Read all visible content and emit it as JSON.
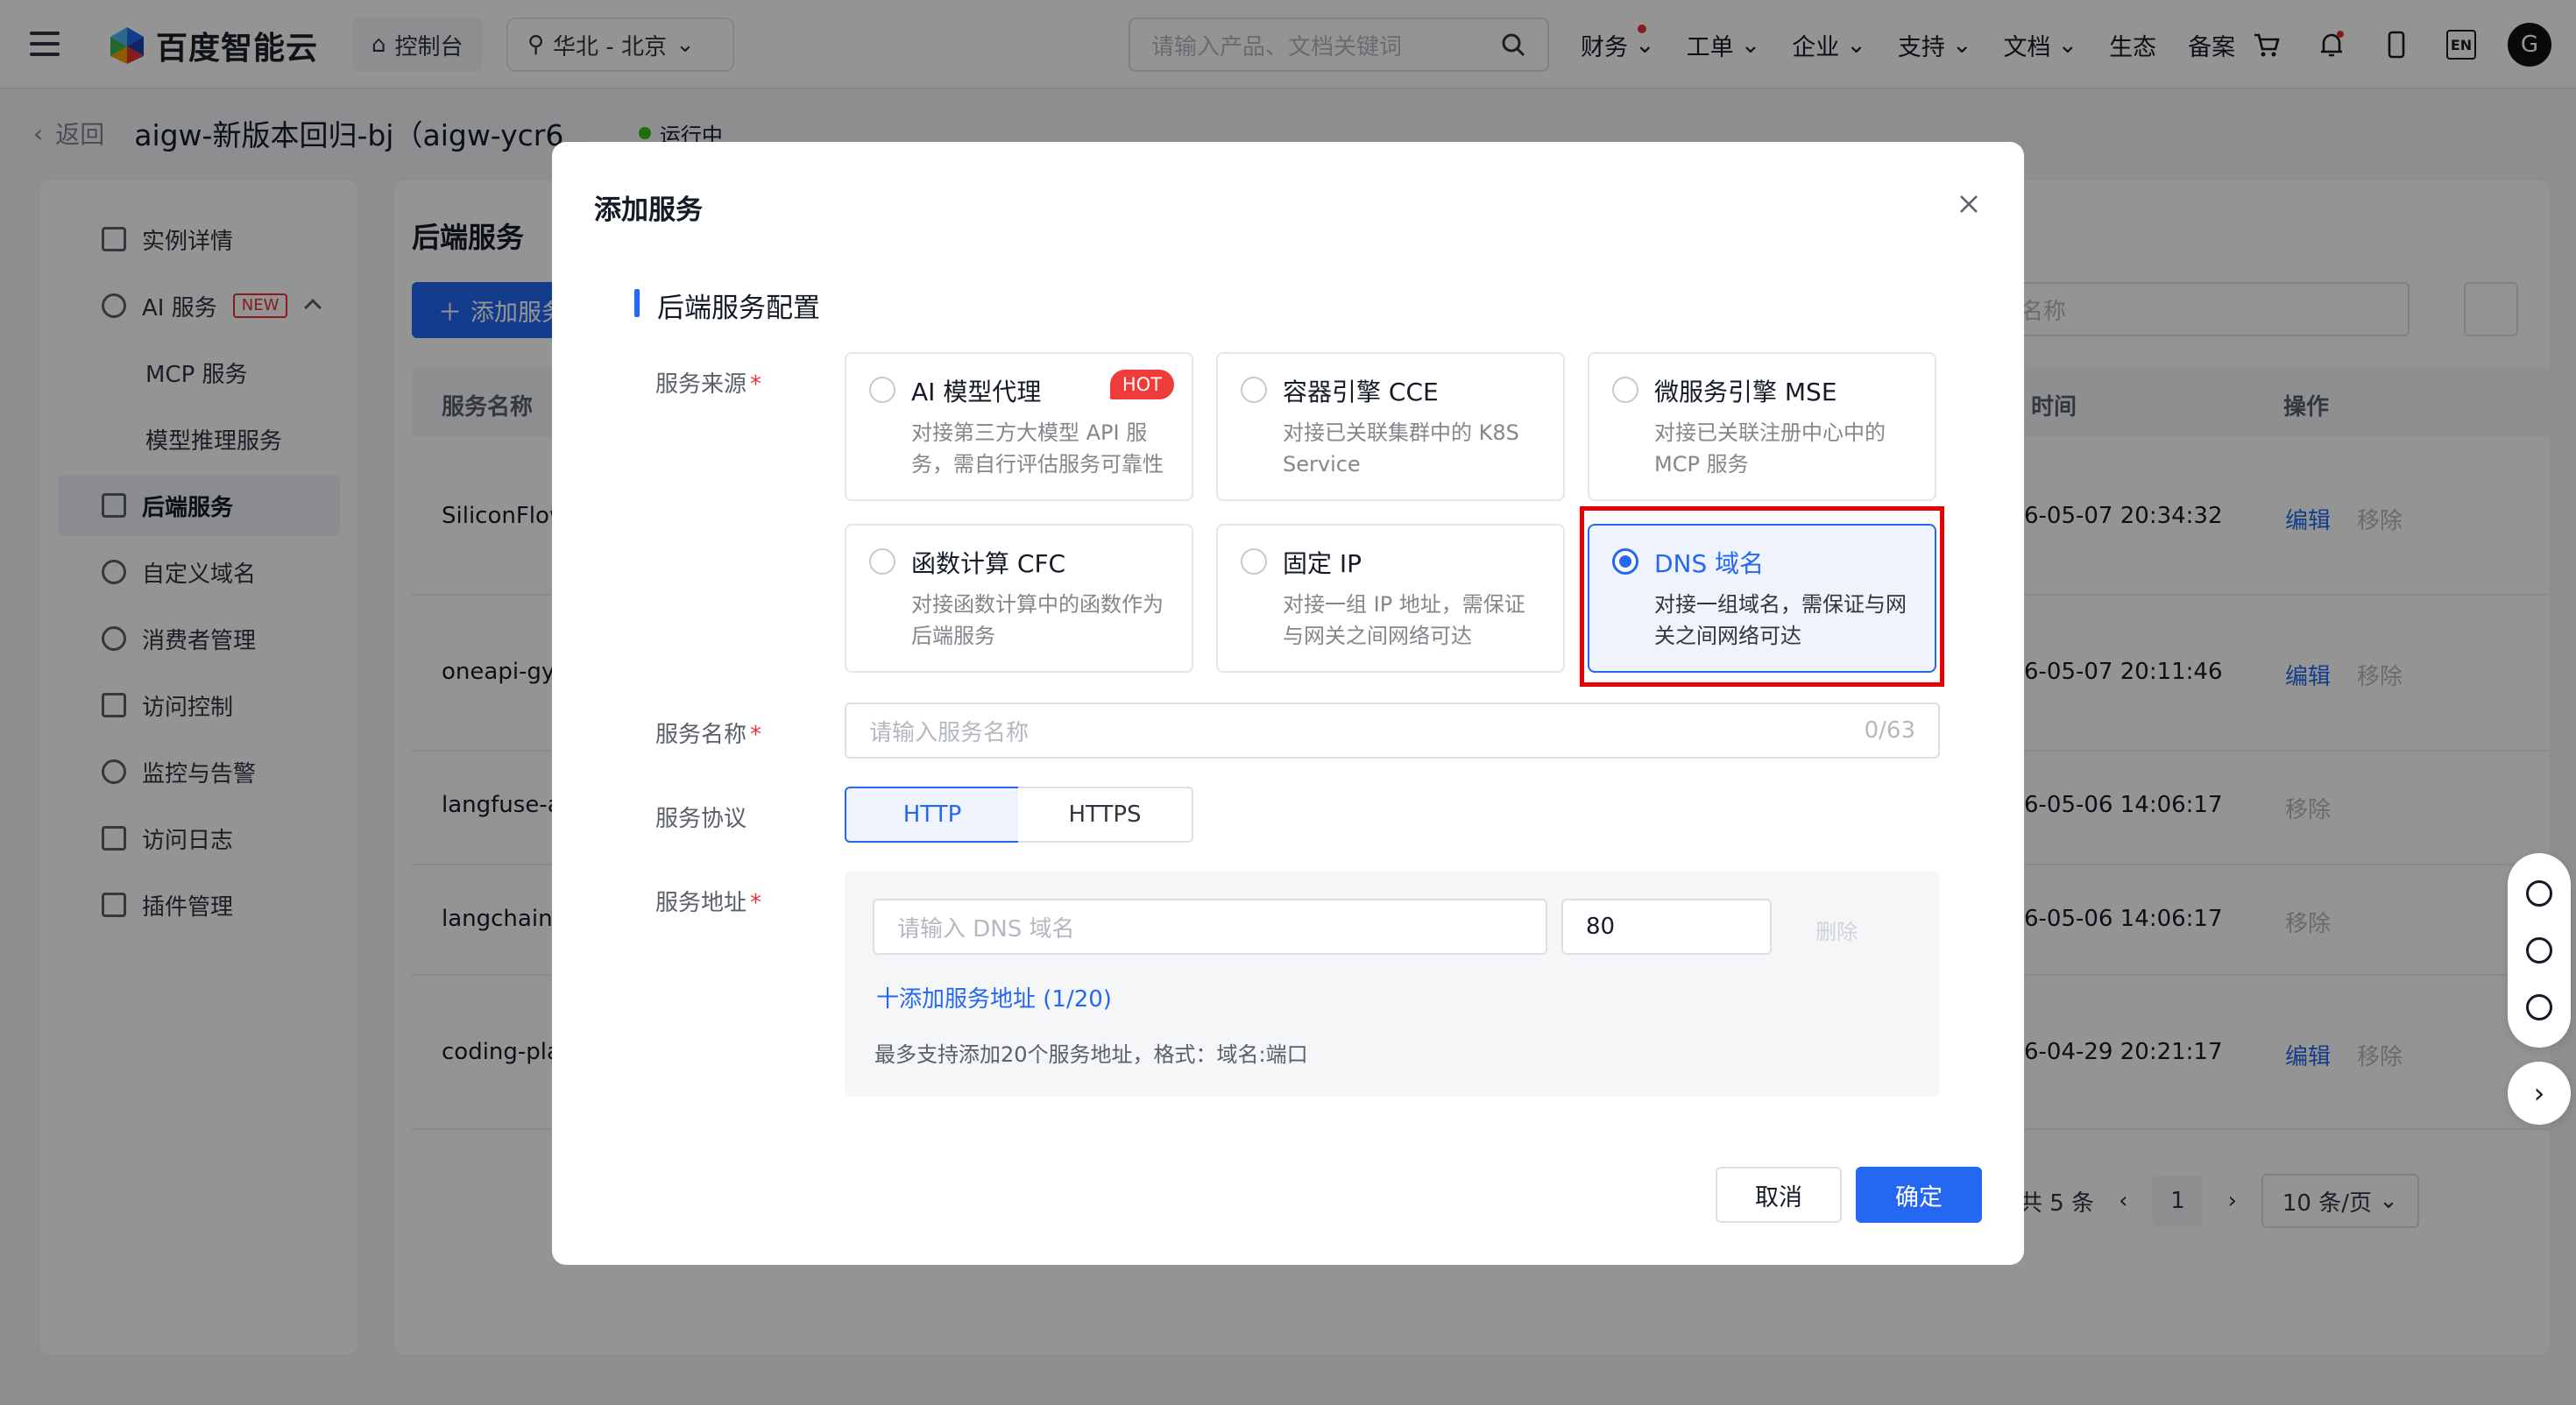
{
  "topnav": {
    "logo_text": "百度智能云",
    "console_label": "控制台",
    "region_label": "华北 - 北京",
    "search_placeholder": "请输入产品、文档关键词",
    "links": [
      "财务",
      "工单",
      "企业",
      "支持",
      "文档",
      "生态",
      "备案"
    ],
    "lang": "EN",
    "avatar_letter": "G"
  },
  "breadcrumb": {
    "back": "返回",
    "title": "aigw-新版本回归-bj（aigw-ycr6...",
    "status": "运行中"
  },
  "sidebar": {
    "items": [
      {
        "label": "实例详情"
      },
      {
        "label": "AI 服务",
        "badge": "NEW"
      },
      {
        "label": "MCP 服务"
      },
      {
        "label": "模型推理服务"
      },
      {
        "label": "后端服务"
      },
      {
        "label": "自定义域名"
      },
      {
        "label": "消费者管理"
      },
      {
        "label": "访问控制"
      },
      {
        "label": "监控与告警"
      },
      {
        "label": "访问日志"
      },
      {
        "label": "插件管理"
      }
    ]
  },
  "main": {
    "title": "后端服务",
    "add_button": "添加服务",
    "search_placeholder": "名称",
    "columns": {
      "name": "服务名称",
      "time": "时间",
      "ops": "操作"
    },
    "rows": [
      {
        "name": "SiliconFlow",
        "time": "6-05-07 20:34:32",
        "edit": "编辑",
        "remove": "移除"
      },
      {
        "name": "oneapi-gy",
        "time": "6-05-07 20:11:46",
        "edit": "编辑",
        "remove": "移除"
      },
      {
        "name": "langfuse-a",
        "time": "6-05-06 14:06:17",
        "edit": "",
        "remove": "移除"
      },
      {
        "name": "langchain-",
        "time": "6-05-06 14:06:17",
        "edit": "",
        "remove": "移除"
      },
      {
        "name": "coding-pla",
        "time": "6-04-29 20:21:17",
        "edit": "编辑",
        "remove": "移除"
      }
    ],
    "pager": {
      "total": "共 5 条",
      "current": "1",
      "size": "10 条/页"
    }
  },
  "modal": {
    "title": "添加服务",
    "section_title": "后端服务配置",
    "source_label": "服务来源",
    "cards": [
      {
        "title": "AI 模型代理",
        "desc": "对接第三方大模型 API 服务，需自行评估服务可靠性",
        "badge": "HOT"
      },
      {
        "title": "容器引擎 CCE",
        "desc": "对接已关联集群中的 K8S Service"
      },
      {
        "title": "微服务引擎 MSE",
        "desc": "对接已关联注册中心中的 MCP 服务"
      },
      {
        "title": "函数计算 CFC",
        "desc": "对接函数计算中的函数作为后端服务"
      },
      {
        "title": "固定 IP",
        "desc": "对接一组 IP 地址，需保证与网关之间网络可达"
      },
      {
        "title": "DNS 域名",
        "desc": "对接一组域名，需保证与网关之间网络可达"
      }
    ],
    "selected_card": "DNS 域名",
    "name_label": "服务名称",
    "name_placeholder": "请输入服务名称",
    "name_counter": "0/63",
    "protocol_label": "服务协议",
    "protocols": [
      "HTTP",
      "HTTPS"
    ],
    "address_label": "服务地址",
    "dns_placeholder": "请输入 DNS 域名",
    "port_value": "80",
    "delete_label": "删除",
    "add_address": "十添加服务地址 (1/20)",
    "hint": "最多支持添加20个服务地址，格式：域名:端口",
    "cancel": "取消",
    "confirm": "确定"
  },
  "colors": {
    "primary": "#2468f2",
    "danger": "#e8312d",
    "running": "#30bf13"
  }
}
